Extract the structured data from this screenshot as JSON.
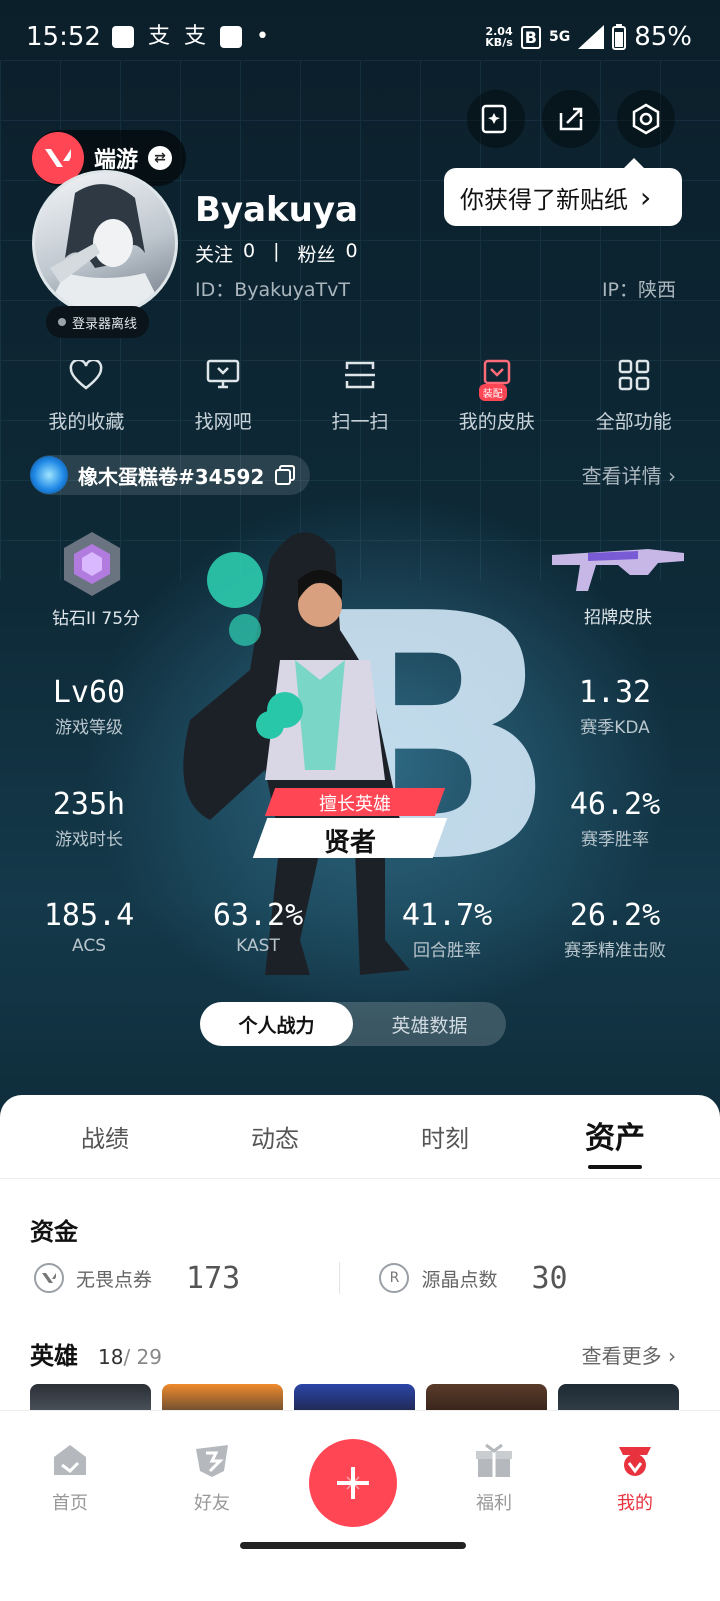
{
  "status_bar": {
    "time": "15:52",
    "speed_top": "2.04",
    "speed_unit": "KB/s",
    "network": "5G",
    "battery": "85%"
  },
  "top_actions": {
    "sticker_icon": "sticker-edit-icon",
    "share_icon": "share-icon",
    "settings_icon": "settings-icon"
  },
  "tooltip": {
    "text": "你获得了新贴纸",
    "chevron": "›"
  },
  "game_switch": {
    "label": "端游",
    "swap": "⇄"
  },
  "profile": {
    "offline_status": "登录器离线",
    "username": "Byakuya",
    "following_label": "关注",
    "following_count": "0",
    "separator": "|",
    "fans_label": "粉丝",
    "fans_count": "0",
    "id_text": "ID：ByakuyaTvT",
    "ip_text": "IP：陕西"
  },
  "quick_actions": [
    {
      "label": "我的收藏",
      "icon": "heart-icon"
    },
    {
      "label": "找网吧",
      "icon": "monitor-icon"
    },
    {
      "label": "扫一扫",
      "icon": "scan-icon"
    },
    {
      "label": "我的皮肤",
      "icon": "skin-icon",
      "badge": "装配"
    },
    {
      "label": "全部功能",
      "icon": "grid-icon"
    }
  ],
  "riot_id": {
    "name": "橡木蛋糕卷#34592",
    "detail_link": "查看详情 ›"
  },
  "rank": {
    "label": "钻石II 75分"
  },
  "signature_skin": {
    "label": "招牌皮肤"
  },
  "stats": {
    "level": {
      "value": "Lv60",
      "label": "游戏等级"
    },
    "kda": {
      "value": "1.32",
      "label": "赛季KDA"
    },
    "playtime": {
      "value": "235h",
      "label": "游戏时长"
    },
    "winrate": {
      "value": "46.2%",
      "label": "赛季胜率"
    },
    "acs": {
      "value": "185.4",
      "label": "ACS"
    },
    "kast": {
      "value": "63.2%",
      "label": "KAST"
    },
    "round_winrate": {
      "value": "41.7%",
      "label": "回合胜率"
    },
    "headshot": {
      "value": "26.2%",
      "label": "赛季精准击败"
    }
  },
  "hero_tag": {
    "top": "擅长英雄",
    "name": "贤者",
    "rank_letter": "B"
  },
  "segment": {
    "left": "个人战力",
    "right": "英雄数据"
  },
  "tabs": [
    "战绩",
    "动态",
    "时刻",
    "资产"
  ],
  "assets": {
    "funds_title": "资金",
    "funds": [
      {
        "label": "无畏点券",
        "value": "173",
        "icon": "valorant-points-icon"
      },
      {
        "label": "源晶点数",
        "value": "30",
        "icon": "radianite-icon",
        "glyph": "R"
      }
    ],
    "heroes_title": "英雄",
    "heroes_owned": "18",
    "heroes_total": "/ 29",
    "more_link": "查看更多 ›"
  },
  "bottom_nav": [
    {
      "label": "首页",
      "icon": "home-icon"
    },
    {
      "label": "好友",
      "icon": "friends-icon"
    },
    {
      "label": "福利",
      "icon": "gift-icon"
    },
    {
      "label": "我的",
      "icon": "profile-icon"
    }
  ],
  "colors": {
    "accent": "#ff4655",
    "nav_active": "#e8323e"
  }
}
